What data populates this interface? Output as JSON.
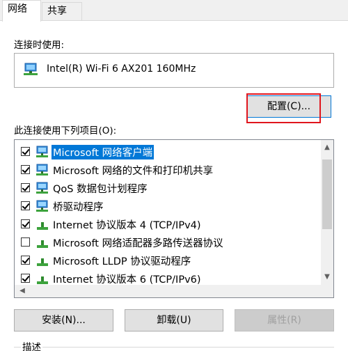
{
  "tabs": [
    {
      "label": "网络",
      "active": true
    },
    {
      "label": "共享",
      "active": false
    }
  ],
  "connect_label": "连接时使用:",
  "adapter": {
    "name": "Intel(R) Wi-Fi 6 AX201 160MHz",
    "icon": "network-adapter-icon"
  },
  "configure_button": "配置(C)...",
  "items_label": "此连接使用下列项目(O):",
  "items": [
    {
      "label": "Microsoft 网络客户端",
      "checked": true,
      "selected": true,
      "icon": "network-client-icon"
    },
    {
      "label": "Microsoft 网络的文件和打印机共享",
      "checked": true,
      "selected": false,
      "icon": "network-client-icon"
    },
    {
      "label": "QoS 数据包计划程序",
      "checked": true,
      "selected": false,
      "icon": "network-client-icon"
    },
    {
      "label": "桥驱动程序",
      "checked": true,
      "selected": false,
      "icon": "network-client-icon"
    },
    {
      "label": "Internet 协议版本 4 (TCP/IPv4)",
      "checked": true,
      "selected": false,
      "icon": "protocol-icon"
    },
    {
      "label": "Microsoft 网络适配器多路传送器协议",
      "checked": false,
      "selected": false,
      "icon": "protocol-icon"
    },
    {
      "label": "Microsoft LLDP 协议驱动程序",
      "checked": true,
      "selected": false,
      "icon": "protocol-icon"
    },
    {
      "label": "Internet 协议版本 6 (TCP/IPv6)",
      "checked": true,
      "selected": false,
      "icon": "protocol-icon"
    }
  ],
  "buttons": {
    "install": "安装(N)...",
    "uninstall": "卸载(U)",
    "properties": "属性(R)"
  },
  "description_label": "描述",
  "colors": {
    "selection": "#0078d7",
    "highlight_box": "#e0151d"
  }
}
